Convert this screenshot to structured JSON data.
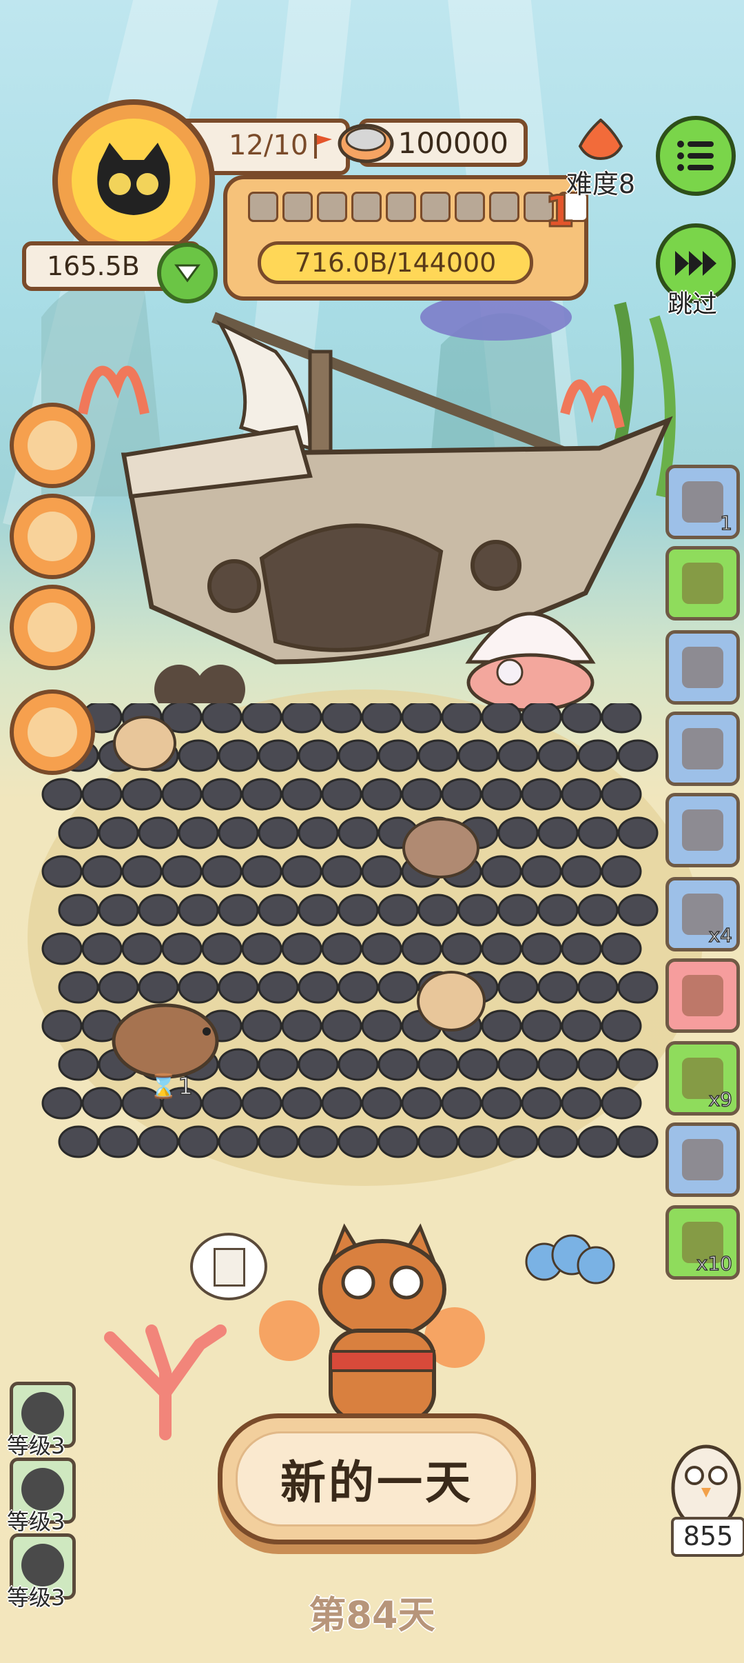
{
  "hud": {
    "level_count": "12/10",
    "coins": "165.5B",
    "cans": "100000",
    "xp_progress": "716.0B/144000",
    "pips_filled": 1,
    "pips_total": 10,
    "pip_level": "1",
    "difficulty": "难度8",
    "skip_label": "跳过"
  },
  "right_items": [
    {
      "icon": "shovel-icon",
      "count": "1",
      "style": "blue",
      "timer": true
    },
    {
      "icon": "card-icon",
      "count": "",
      "style": "green"
    },
    {
      "icon": "hut-icon",
      "count": "",
      "style": "blue"
    },
    {
      "icon": "crate-icon",
      "count": "",
      "style": "blue"
    },
    {
      "icon": "cat-bed-icon",
      "count": "",
      "style": "blue"
    },
    {
      "icon": "scythe-icon",
      "count": "x4",
      "style": "blue"
    },
    {
      "icon": "coral-gift-icon",
      "count": "",
      "style": "pink"
    },
    {
      "icon": "worm-icon",
      "count": "x9",
      "style": "green"
    },
    {
      "icon": "bag-icon",
      "count": "",
      "style": "blue"
    },
    {
      "icon": "ticket-icon",
      "count": "x10",
      "style": "green"
    }
  ],
  "level_badges": [
    "等级3",
    "等级3",
    "等级3"
  ],
  "field_timer": "1",
  "main_button": "新的一天",
  "day_label": "第84天",
  "owl_count": "855",
  "colors": {
    "accent_green": "#7ad54a",
    "brown_outline": "#7a4b2a",
    "orange": "#f6a04e"
  }
}
